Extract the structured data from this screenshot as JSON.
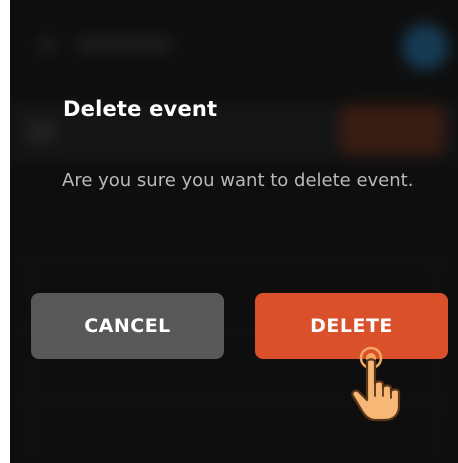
{
  "dialog": {
    "title": "Delete event",
    "message": "Are you sure you want to delete event.",
    "cancel_label": "CANCEL",
    "delete_label": "DELETE"
  },
  "colors": {
    "delete_button": "#d9502a",
    "cancel_button": "#585858",
    "background": "#101010"
  },
  "icons": {
    "cursor": "hand-pointer-icon"
  }
}
